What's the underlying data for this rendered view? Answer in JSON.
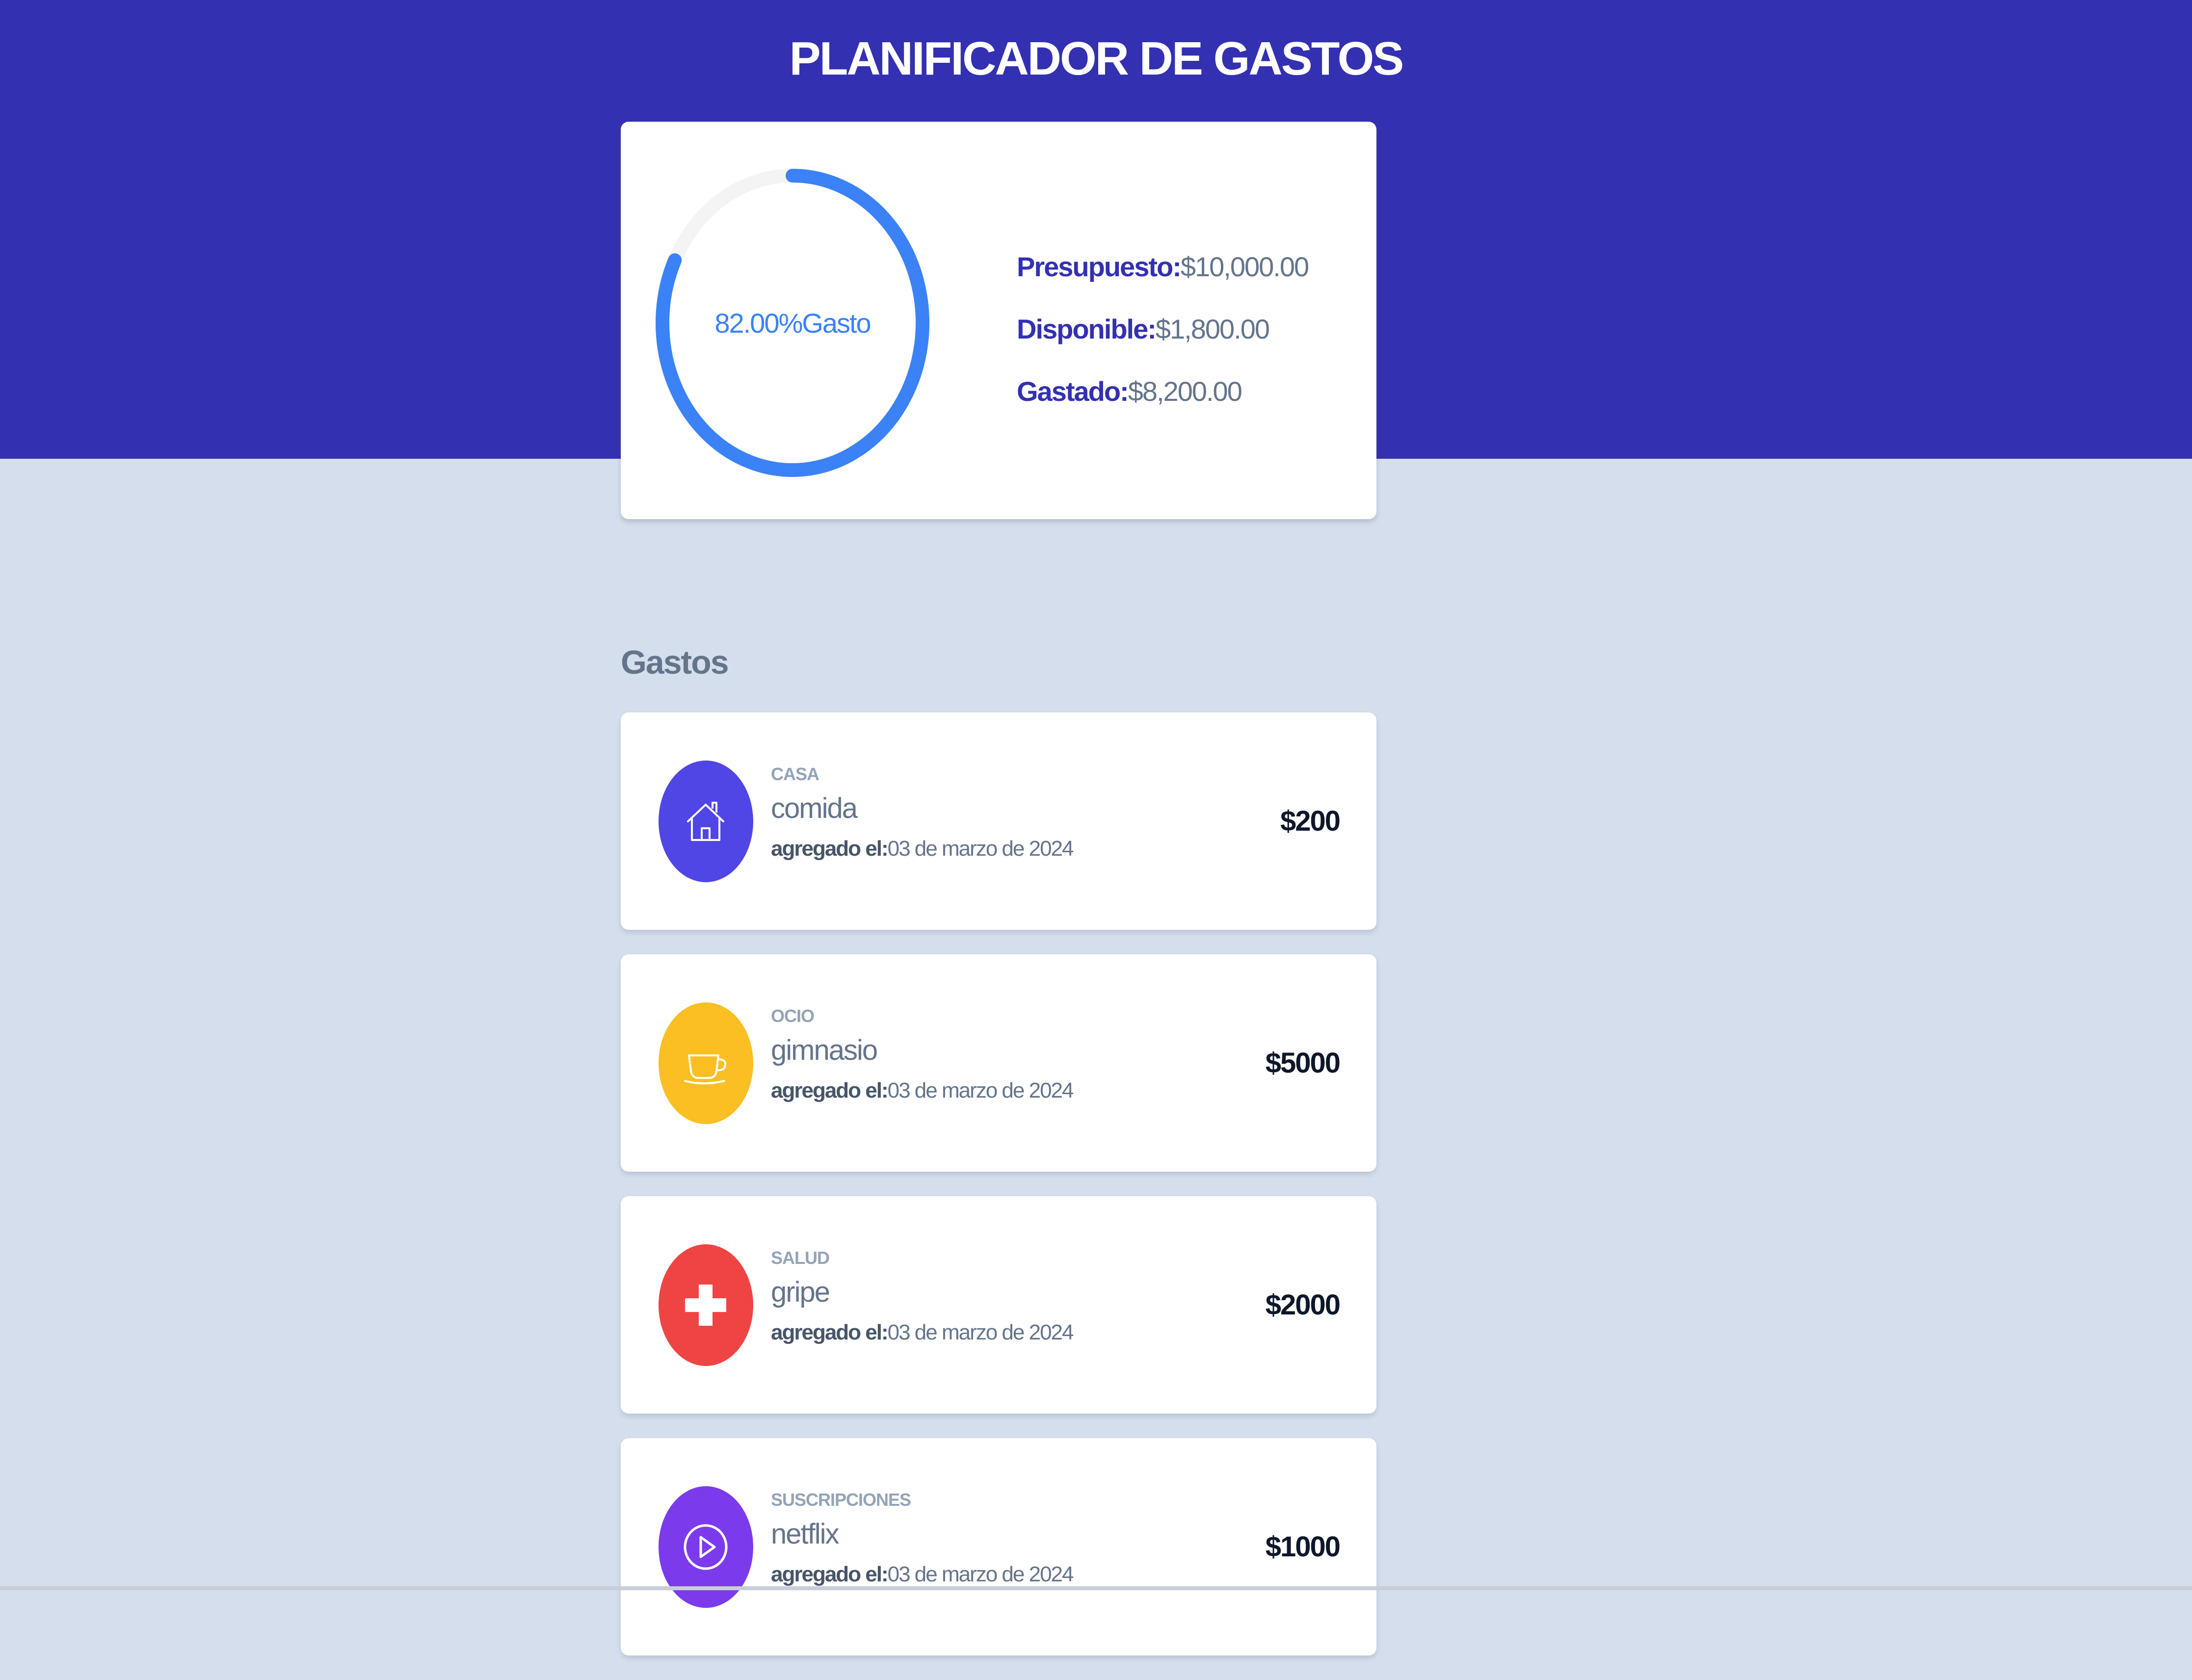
{
  "header": {
    "title": "PLANIFICADOR DE GASTOS"
  },
  "budget": {
    "percent_spent": 82,
    "donut_label": "82.00%Gasto",
    "presupuesto_label": "Presupuesto:",
    "presupuesto_value": "$10,000.00",
    "disponible_label": "Disponible:",
    "disponible_value": "$1,800.00",
    "gastado_label": "Gastado:",
    "gastado_value": "$8,200.00"
  },
  "expenses_section": {
    "title": "Gastos",
    "items": [
      {
        "category": "CASA",
        "name": "comida",
        "date_label": "agregado el:",
        "date": "03 de marzo de 2024",
        "amount": "$200",
        "icon": "house-icon",
        "color": "#5046e5"
      },
      {
        "category": "OCIO",
        "name": "gimnasio",
        "date_label": "agregado el:",
        "date": "03 de marzo de 2024",
        "amount": "$5000",
        "icon": "coffee-cup-icon",
        "color": "#fbbf24"
      },
      {
        "category": "SALUD",
        "name": "gripe",
        "date_label": "agregado el:",
        "date": "03 de marzo de 2024",
        "amount": "$2000",
        "icon": "medical-cross-icon",
        "color": "#ef4444"
      },
      {
        "category": "SUSCRIPCIONES",
        "name": "netflix",
        "date_label": "agregado el:",
        "date": "03 de marzo de 2024",
        "amount": "$1000",
        "icon": "play-icon",
        "color": "#7c3aed"
      }
    ]
  },
  "colors": {
    "header_bg": "#3430b2",
    "page_bg": "#d4deec",
    "progress": "#3b82f6",
    "track": "#f5f5f5"
  }
}
